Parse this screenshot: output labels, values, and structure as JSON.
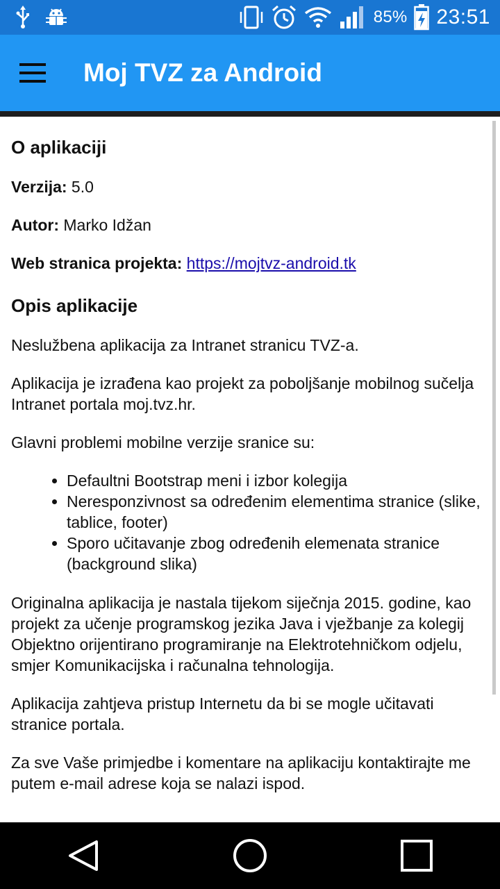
{
  "status_bar": {
    "battery_percent": "85%",
    "time": "23:51",
    "icons": [
      "usb-icon",
      "android-debug-icon",
      "vibrate-icon",
      "alarm-icon",
      "wifi-icon",
      "signal-icon",
      "battery-charging-icon"
    ]
  },
  "app_bar": {
    "title": "Moj TVZ za Android",
    "menu_icon": "hamburger-menu-icon"
  },
  "content": {
    "about_heading": "O aplikaciji",
    "version_label": "Verzija:",
    "version_value": " 5.0",
    "author_label": "Autor:",
    "author_value": " Marko Idžan",
    "web_label": "Web stranica projekta:",
    "web_link": "https://mojtvz-android.tk",
    "desc_heading": "Opis aplikacije",
    "p1": "Neslužbena aplikacija za Intranet stranicu TVZ-a.",
    "p2": "Aplikacija je izrađena kao projekt za poboljšanje mobilnog sučelja Intranet portala moj.tvz.hr.",
    "p3": "Glavni problemi mobilne verzije sranice su:",
    "problems": [
      "Defaultni Bootstrap meni i izbor kolegija",
      "Neresponzivnost sa određenim elementima stranice (slike, tablice, footer)",
      "Sporo učitavanje zbog određenih elemenata stranice (background slika)"
    ],
    "p4": "Originalna aplikacija je nastala tijekom siječnja 2015. godine, kao projekt za učenje programskog jezika Java i vježbanje za kolegij Objektno orijentirano programiranje na Elektrotehničkom odjelu, smjer Komunikacijska i računalna tehnologija.",
    "p5": "Aplikacija zahtjeva pristup Internetu da bi se mogle učitavati stranice portala.",
    "p6": "Za sve Vaše primjedbe i komentare na aplikaciju kontaktirajte me putem e-mail adrese koja se nalazi ispod."
  },
  "nav_bar": {
    "back": "back-icon",
    "home": "home-icon",
    "recents": "recents-icon"
  },
  "colors": {
    "status_bar": "#1976d2",
    "app_bar": "#2196f3",
    "link": "#1a0dab"
  }
}
